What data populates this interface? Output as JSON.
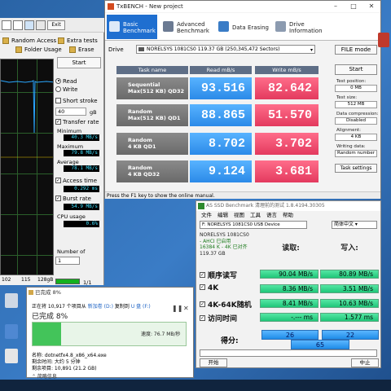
{
  "hdtune": {
    "exit_label": "Exit",
    "tabs": {
      "random_access": "Random Access",
      "extra_tests": "Extra tests",
      "folder_usage": "Folder Usage",
      "erase": "Erase"
    },
    "start_label": "Start",
    "read_label": "Read",
    "write_label": "Write",
    "short_stroke_label": "Short stroke",
    "short_stroke_value": "40",
    "gb_unit": "gB",
    "transfer_rate_label": "Transfer rate",
    "minimum_label": "Minimum",
    "minimum_value": "40.3 MB/s",
    "maximum_label": "Maximum",
    "maximum_value": "79.8 MB/s",
    "average_label": "Average",
    "average_value": "78.1 MB/s",
    "access_time_label": "Access time",
    "access_time_value": "0.292 ms",
    "burst_rate_label": "Burst rate",
    "burst_rate_value": "54.9 MB/s",
    "cpu_usage_label": "CPU usage",
    "cpu_usage_value": "0.6%",
    "number_of_label": "Number of",
    "number_value": "1",
    "progress_label": "1/1",
    "axis_ticks": [
      "102",
      "115",
      "128gB"
    ]
  },
  "txbench": {
    "title": "TxBENCH - New project",
    "tabs": [
      {
        "line1": "Basic",
        "line2": "Benchmark"
      },
      {
        "line1": "Advanced",
        "line2": "Benchmark"
      },
      {
        "line1": "Data Erasing",
        "line2": ""
      },
      {
        "line1": "Drive",
        "line2": "Information"
      }
    ],
    "drive_label": "Drive",
    "drive_value": "NORELSYS 1081CS0  119.37 GB (250,345,472 Sectors)",
    "file_explorer": "FILE mode",
    "headers": {
      "task": "Task name",
      "read": "Read mB/s",
      "write": "Write mB/s"
    },
    "rows": [
      {
        "task1": "Sequential",
        "task2": "Max(512 KB) QD32",
        "read": "93.516",
        "write": "82.642"
      },
      {
        "task1": "Random",
        "task2": "Max(512 KB) QD1",
        "read": "88.865",
        "write": "51.570"
      },
      {
        "task1": "Random",
        "task2": "4 KB QD1",
        "read": "8.702",
        "write": "3.702"
      },
      {
        "task1": "Random",
        "task2": "4 KB QD32",
        "read": "9.124",
        "write": "3.681"
      }
    ],
    "start_label": "Start",
    "settings": [
      {
        "label": "Test position:",
        "value": "0 MB"
      },
      {
        "label": "Test size:",
        "value": "512 MB"
      },
      {
        "label": "Data compression:",
        "value": "Disabled"
      },
      {
        "label": "Alignment:",
        "value": "4 KB"
      },
      {
        "label": "Writing data:",
        "value": "Random number"
      }
    ],
    "task_settings": "Task settings",
    "status": "Press the F1 key to show the online manual."
  },
  "asssd": {
    "title": "AS SSD Benchmark 清理前的测试 1.8.4194.30305",
    "menu": [
      "文件",
      "编辑",
      "视图",
      "工具",
      "语言",
      "帮助"
    ],
    "drive_select": "F: NORELSYS 1081CS0 USB Device",
    "lang_select": "简体中文 ▾",
    "info": {
      "model": "NORELSYS 1081CS0",
      "fw": "",
      "driver": "- AHCI 已启用",
      "align": "16384 K - 4K 已对齐",
      "size": "119.37 GB"
    },
    "col_read": "读取:",
    "col_write": "写入:",
    "rows": [
      {
        "label": "顺序读写",
        "read": "90.04 MB/s",
        "write": "80.89 MB/s"
      },
      {
        "label": "4K",
        "read": "8.36 MB/s",
        "write": "3.51 MB/s"
      },
      {
        "label": "4K-64K随机",
        "read": "8.41 MB/s",
        "write": "10.63 MB/s"
      },
      {
        "label": "访问时间",
        "read": "-.--- ms",
        "write": "1.577 ms"
      }
    ],
    "score_label": "得分:",
    "score_read": "26",
    "score_write": "22",
    "score_total": "65",
    "start_label": "开始",
    "abort_label": "中止"
  },
  "copy_dialog": {
    "title": "已完成 8%",
    "line1_prefix": "正在将 10,917 个项目从",
    "src": "新加卷 (D:)",
    "line1_mid": "复制到",
    "dst": "U 盘 (F:)",
    "percent_text": "已完成 8%",
    "progress": 0.08,
    "speed": "速度: 76.7 MB/秒",
    "name": "名称: dotnetfx4.8_x86_x64.exe",
    "remaining": "剩余时间: 大约 5 分钟",
    "items": "剩余项目: 10,891 (21.2 GB)",
    "less": "⌃ 简略信息"
  },
  "colors": {
    "tx_read": "#2b8ae8",
    "tx_write": "#e33a5e",
    "as_green": "#1fc679",
    "as_blue": "#1f8de8"
  }
}
